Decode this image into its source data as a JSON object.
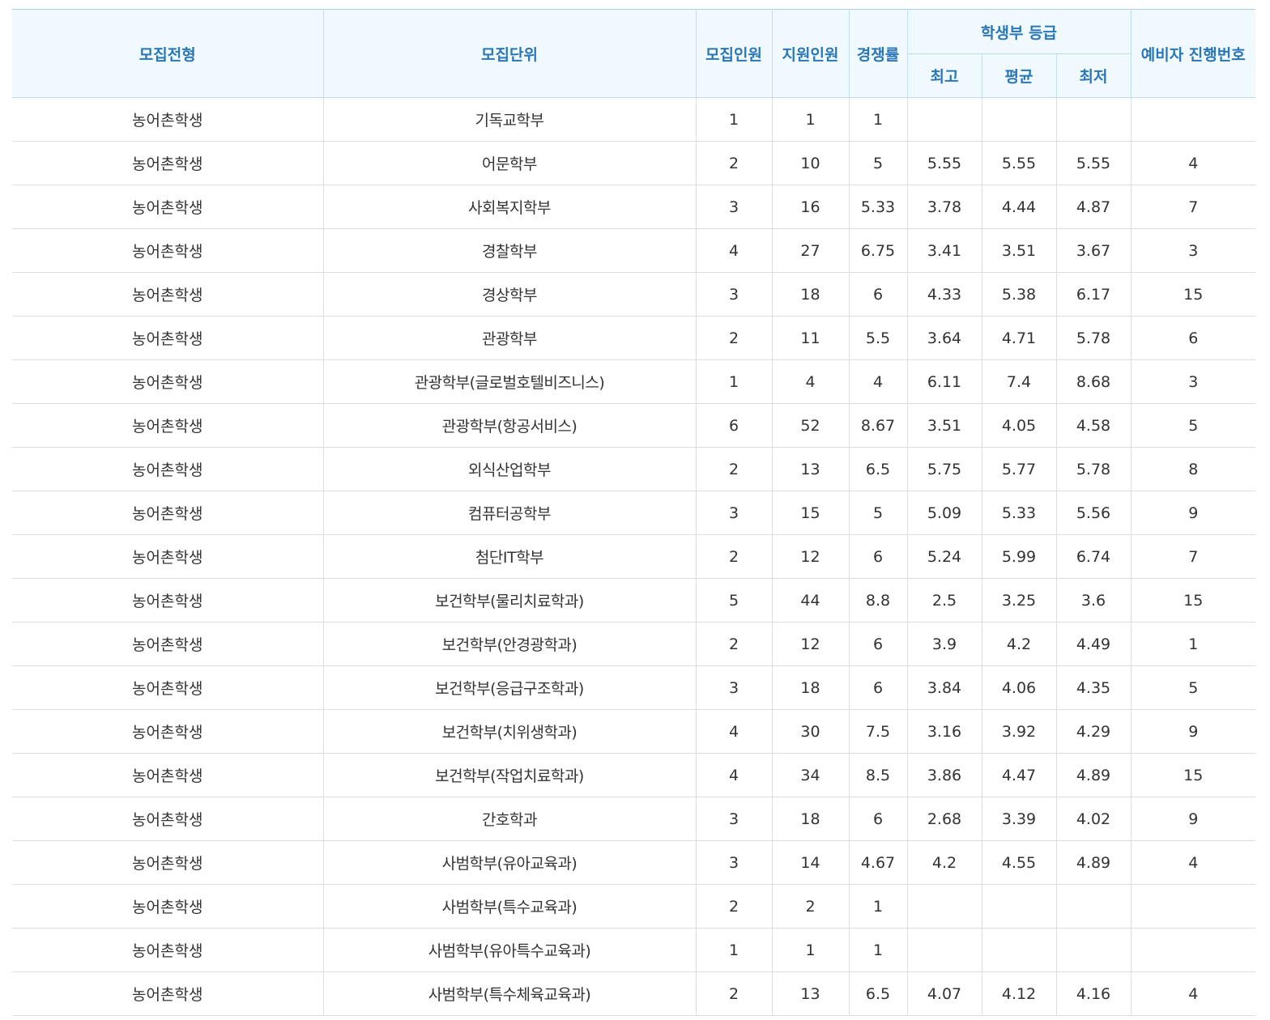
{
  "table": {
    "headers": {
      "type": "모집전형",
      "unit": "모집단위",
      "quota": "모집인원",
      "applicants": "지원인원",
      "ratio": "경쟁률",
      "grade_group": "학생부 등급",
      "grade_max": "최고",
      "grade_avg": "평균",
      "grade_min": "최저",
      "waitlist": "예비자 진행번호"
    },
    "rows": [
      {
        "type": "농어촌학생",
        "unit": "기독교학부",
        "quota": "1",
        "applicants": "1",
        "ratio": "1",
        "max": "",
        "avg": "",
        "min": "",
        "wait": ""
      },
      {
        "type": "농어촌학생",
        "unit": "어문학부",
        "quota": "2",
        "applicants": "10",
        "ratio": "5",
        "max": "5.55",
        "avg": "5.55",
        "min": "5.55",
        "wait": "4"
      },
      {
        "type": "농어촌학생",
        "unit": "사회복지학부",
        "quota": "3",
        "applicants": "16",
        "ratio": "5.33",
        "max": "3.78",
        "avg": "4.44",
        "min": "4.87",
        "wait": "7"
      },
      {
        "type": "농어촌학생",
        "unit": "경찰학부",
        "quota": "4",
        "applicants": "27",
        "ratio": "6.75",
        "max": "3.41",
        "avg": "3.51",
        "min": "3.67",
        "wait": "3"
      },
      {
        "type": "농어촌학생",
        "unit": "경상학부",
        "quota": "3",
        "applicants": "18",
        "ratio": "6",
        "max": "4.33",
        "avg": "5.38",
        "min": "6.17",
        "wait": "15"
      },
      {
        "type": "농어촌학생",
        "unit": "관광학부",
        "quota": "2",
        "applicants": "11",
        "ratio": "5.5",
        "max": "3.64",
        "avg": "4.71",
        "min": "5.78",
        "wait": "6"
      },
      {
        "type": "농어촌학생",
        "unit": "관광학부(글로벌호텔비즈니스)",
        "quota": "1",
        "applicants": "4",
        "ratio": "4",
        "max": "6.11",
        "avg": "7.4",
        "min": "8.68",
        "wait": "3"
      },
      {
        "type": "농어촌학생",
        "unit": "관광학부(항공서비스)",
        "quota": "6",
        "applicants": "52",
        "ratio": "8.67",
        "max": "3.51",
        "avg": "4.05",
        "min": "4.58",
        "wait": "5"
      },
      {
        "type": "농어촌학생",
        "unit": "외식산업학부",
        "quota": "2",
        "applicants": "13",
        "ratio": "6.5",
        "max": "5.75",
        "avg": "5.77",
        "min": "5.78",
        "wait": "8"
      },
      {
        "type": "농어촌학생",
        "unit": "컴퓨터공학부",
        "quota": "3",
        "applicants": "15",
        "ratio": "5",
        "max": "5.09",
        "avg": "5.33",
        "min": "5.56",
        "wait": "9"
      },
      {
        "type": "농어촌학생",
        "unit": "첨단IT학부",
        "quota": "2",
        "applicants": "12",
        "ratio": "6",
        "max": "5.24",
        "avg": "5.99",
        "min": "6.74",
        "wait": "7"
      },
      {
        "type": "농어촌학생",
        "unit": "보건학부(물리치료학과)",
        "quota": "5",
        "applicants": "44",
        "ratio": "8.8",
        "max": "2.5",
        "avg": "3.25",
        "min": "3.6",
        "wait": "15"
      },
      {
        "type": "농어촌학생",
        "unit": "보건학부(안경광학과)",
        "quota": "2",
        "applicants": "12",
        "ratio": "6",
        "max": "3.9",
        "avg": "4.2",
        "min": "4.49",
        "wait": "1"
      },
      {
        "type": "농어촌학생",
        "unit": "보건학부(응급구조학과)",
        "quota": "3",
        "applicants": "18",
        "ratio": "6",
        "max": "3.84",
        "avg": "4.06",
        "min": "4.35",
        "wait": "5"
      },
      {
        "type": "농어촌학생",
        "unit": "보건학부(치위생학과)",
        "quota": "4",
        "applicants": "30",
        "ratio": "7.5",
        "max": "3.16",
        "avg": "3.92",
        "min": "4.29",
        "wait": "9"
      },
      {
        "type": "농어촌학생",
        "unit": "보건학부(작업치료학과)",
        "quota": "4",
        "applicants": "34",
        "ratio": "8.5",
        "max": "3.86",
        "avg": "4.47",
        "min": "4.89",
        "wait": "15"
      },
      {
        "type": "농어촌학생",
        "unit": "간호학과",
        "quota": "3",
        "applicants": "18",
        "ratio": "6",
        "max": "2.68",
        "avg": "3.39",
        "min": "4.02",
        "wait": "9"
      },
      {
        "type": "농어촌학생",
        "unit": "사범학부(유아교육과)",
        "quota": "3",
        "applicants": "14",
        "ratio": "4.67",
        "max": "4.2",
        "avg": "4.55",
        "min": "4.89",
        "wait": "4"
      },
      {
        "type": "농어촌학생",
        "unit": "사범학부(특수교육과)",
        "quota": "2",
        "applicants": "2",
        "ratio": "1",
        "max": "",
        "avg": "",
        "min": "",
        "wait": ""
      },
      {
        "type": "농어촌학생",
        "unit": "사범학부(유아특수교육과)",
        "quota": "1",
        "applicants": "1",
        "ratio": "1",
        "max": "",
        "avg": "",
        "min": "",
        "wait": ""
      },
      {
        "type": "농어촌학생",
        "unit": "사범학부(특수체육교육과)",
        "quota": "2",
        "applicants": "13",
        "ratio": "6.5",
        "max": "4.07",
        "avg": "4.12",
        "min": "4.16",
        "wait": "4"
      }
    ]
  }
}
